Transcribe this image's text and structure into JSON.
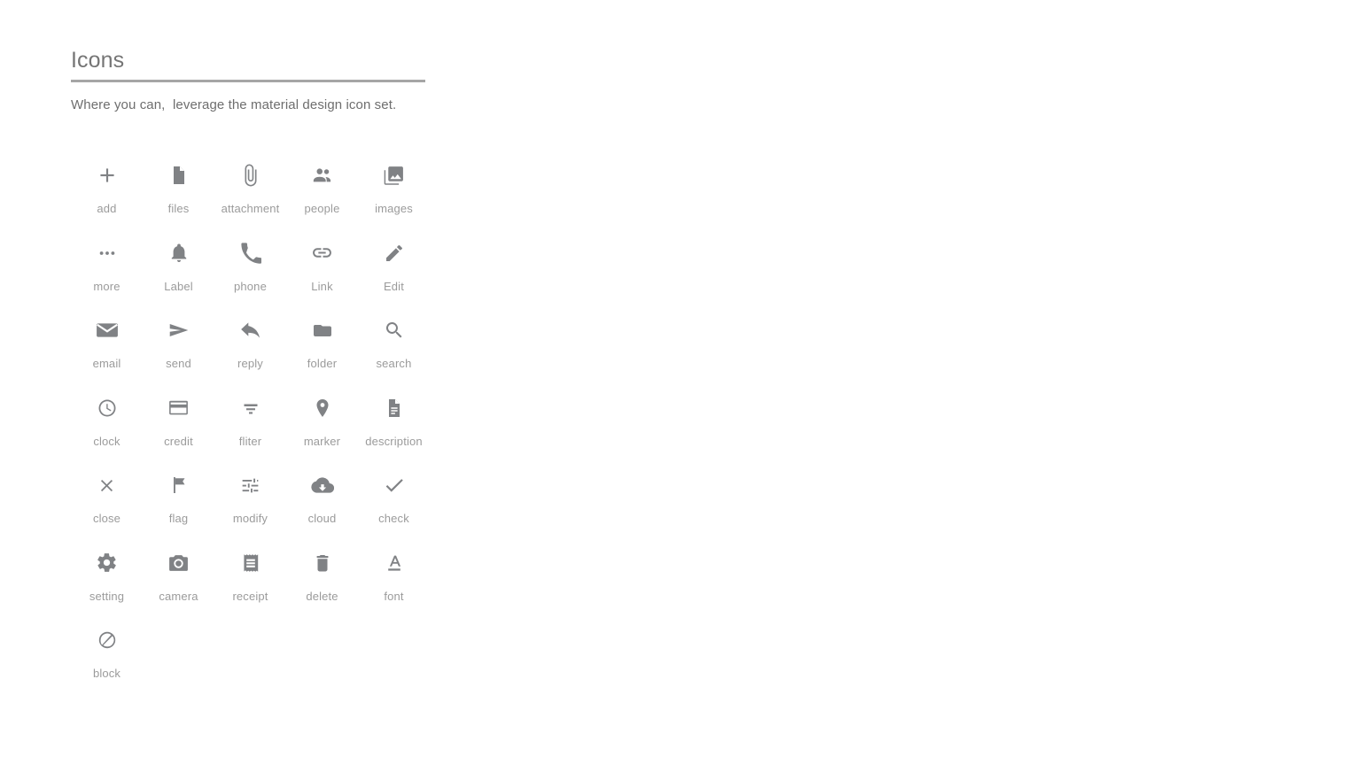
{
  "header": {
    "title": "Icons",
    "subtitle": "Where you can,  leverage the material design icon set."
  },
  "colors": {
    "background": "#ffffff",
    "title_text": "#757575",
    "rule": "#a6a6a6",
    "subtitle_text": "#6e6e6e",
    "icon_fill": "#808285",
    "label_text": "#9b9b9b"
  },
  "icons": [
    {
      "label": "add",
      "icon": "plus-icon"
    },
    {
      "label": "files",
      "icon": "document-icon"
    },
    {
      "label": "attachment",
      "icon": "paperclip-icon"
    },
    {
      "label": "people",
      "icon": "people-icon"
    },
    {
      "label": "images",
      "icon": "photo-library-icon"
    },
    {
      "label": "more",
      "icon": "ellipsis-icon"
    },
    {
      "label": "Label",
      "icon": "bell-icon"
    },
    {
      "label": "phone",
      "icon": "phone-icon"
    },
    {
      "label": "Link",
      "icon": "link-icon"
    },
    {
      "label": "Edit",
      "icon": "pencil-icon"
    },
    {
      "label": "email",
      "icon": "envelope-icon"
    },
    {
      "label": "send",
      "icon": "send-icon"
    },
    {
      "label": "reply",
      "icon": "reply-arrow-icon"
    },
    {
      "label": "folder",
      "icon": "folder-icon"
    },
    {
      "label": "search",
      "icon": "magnifier-icon"
    },
    {
      "label": "clock",
      "icon": "clock-icon"
    },
    {
      "label": "credit",
      "icon": "credit-card-icon"
    },
    {
      "label": "fliter",
      "icon": "filter-list-icon"
    },
    {
      "label": "marker",
      "icon": "map-pin-icon"
    },
    {
      "label": "description",
      "icon": "description-icon"
    },
    {
      "label": "close",
      "icon": "close-x-icon"
    },
    {
      "label": "flag",
      "icon": "flag-icon"
    },
    {
      "label": "modify",
      "icon": "tune-sliders-icon"
    },
    {
      "label": "cloud",
      "icon": "cloud-download-icon"
    },
    {
      "label": "check",
      "icon": "checkmark-icon"
    },
    {
      "label": "setting",
      "icon": "gear-icon"
    },
    {
      "label": "camera",
      "icon": "camera-icon"
    },
    {
      "label": "receipt",
      "icon": "receipt-icon"
    },
    {
      "label": "delete",
      "icon": "trash-icon"
    },
    {
      "label": "font",
      "icon": "font-format-icon"
    },
    {
      "label": "block",
      "icon": "block-icon"
    }
  ]
}
